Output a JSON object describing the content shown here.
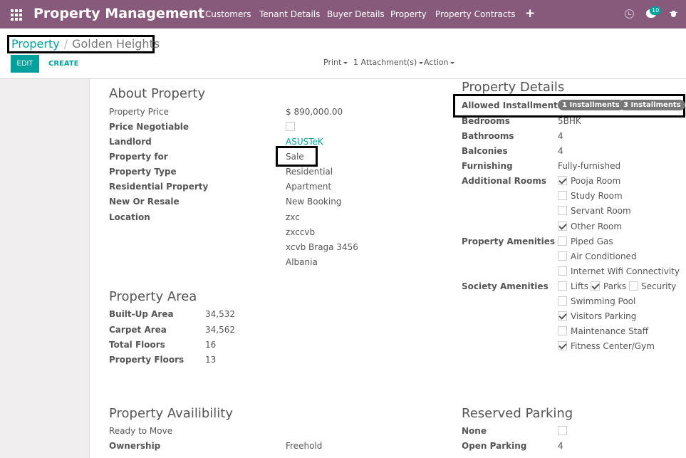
{
  "navbar": {
    "brand": "Property Management",
    "menu": [
      "Customers",
      "Tenant Details",
      "Buyer Details",
      "Property",
      "Property Contracts"
    ],
    "plus": "+",
    "messages_count": "10"
  },
  "breadcrumb": {
    "parent": "Property",
    "separator": "/",
    "current": "Golden Heights"
  },
  "buttons": {
    "edit": "EDIT",
    "create": "CREATE"
  },
  "sidebar": {
    "print": "Print",
    "attachments": "1 Attachment(s)",
    "action": "Action"
  },
  "about": {
    "title": "About Property",
    "price_label": "Property Price",
    "price": "$ 890,000.00",
    "negotiable_label": "Price Negotiable",
    "landlord_label": "Landlord",
    "landlord": "ASUSTeK",
    "property_for_label": "Property for",
    "property_for": "Sale",
    "type_label": "Property Type",
    "type": "Residential",
    "residential_label": "Residential Property",
    "residential": "Apartment",
    "new_resale_label": "New Or Resale",
    "new_resale": "New Booking",
    "location_label": "Location",
    "location": [
      "zxc",
      "zxccvb",
      "xcvb Braga 3456",
      "Albania"
    ]
  },
  "area": {
    "title": "Property Area",
    "built_up_label": "Built-Up Area",
    "built_up": "34,532",
    "carpet_label": "Carpet Area",
    "carpet": "34,562",
    "total_floors_label": "Total Floors",
    "total_floors": "16",
    "property_floors_label": "Property Floors",
    "property_floors": "13"
  },
  "details": {
    "title": "Property Details",
    "installments_label": "Allowed Installments",
    "installments": [
      "1 Installments",
      "3 Installments"
    ],
    "bedrooms_label": "Bedrooms",
    "bedrooms": "5BHK",
    "bathrooms_label": "Bathrooms",
    "bathrooms": "4",
    "balconies_label": "Balconies",
    "balconies": "4",
    "furnishing_label": "Furnishing",
    "furnishing": "Fully-furnished",
    "additional_rooms_label": "Additional Rooms",
    "additional_rooms": [
      {
        "label": "Pooja Room",
        "checked": true
      },
      {
        "label": "Study Room",
        "checked": false
      },
      {
        "label": "Servant Room",
        "checked": false
      },
      {
        "label": "Other Room",
        "checked": true
      }
    ],
    "amenities_label": "Property Amenities",
    "amenities": [
      {
        "label": "Piped Gas",
        "checked": false
      },
      {
        "label": "Air Conditioned",
        "checked": false
      },
      {
        "label": "Internet Wifi Connectivity",
        "checked": false
      }
    ],
    "society_label": "Society Amenities",
    "society_row": [
      {
        "label": "Lifts",
        "checked": false
      },
      {
        "label": "Parks",
        "checked": true
      },
      {
        "label": "Security",
        "checked": false
      }
    ],
    "society": [
      {
        "label": "Swimming Pool",
        "checked": false
      },
      {
        "label": "Visitors Parking",
        "checked": true
      },
      {
        "label": "Maintenance Staff",
        "checked": false
      },
      {
        "label": "Fitness Center/Gym",
        "checked": true
      }
    ]
  },
  "availability": {
    "title": "Property Availibility",
    "ready": "Ready to Move",
    "ownership_label": "Ownership",
    "ownership": "Freehold"
  },
  "parking": {
    "title": "Reserved Parking",
    "none_label": "None",
    "open_label": "Open Parking",
    "open": "4"
  }
}
